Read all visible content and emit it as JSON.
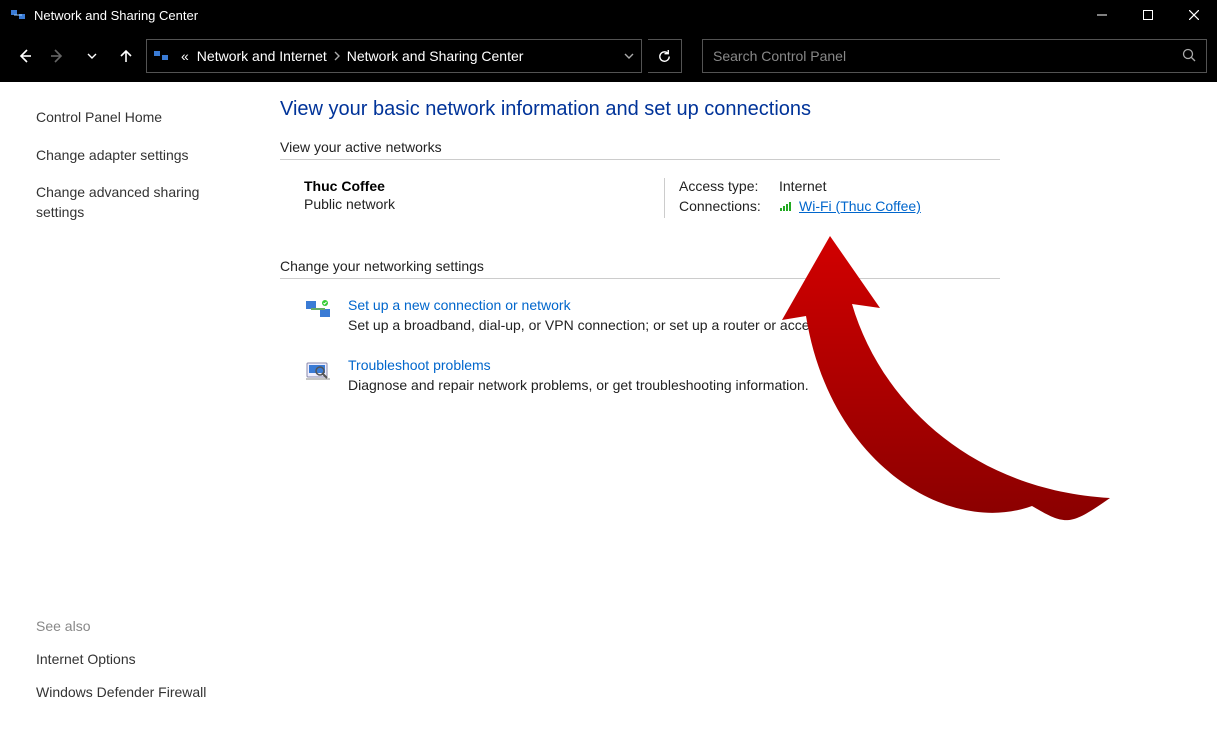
{
  "window": {
    "title": "Network and Sharing Center"
  },
  "breadcrumb": {
    "prefix": "«",
    "seg1": "Network and Internet",
    "seg2": "Network and Sharing Center"
  },
  "search": {
    "placeholder": "Search Control Panel"
  },
  "sidebar": {
    "home": "Control Panel Home",
    "adapter": "Change adapter settings",
    "advanced": "Change advanced sharing settings",
    "see_also": "See also",
    "internet_options": "Internet Options",
    "firewall": "Windows Defender Firewall"
  },
  "main": {
    "heading": "View your basic network information and set up connections",
    "active_header": "View your active networks",
    "network": {
      "name": "Thuc Coffee",
      "type": "Public network",
      "access_label": "Access type:",
      "access_value": "Internet",
      "connections_label": "Connections:",
      "connection_link": "Wi-Fi (Thuc Coffee)"
    },
    "change_header": "Change your networking settings",
    "setup": {
      "title": "Set up a new connection or network",
      "desc": "Set up a broadband, dial-up, or VPN connection; or set up a router or access point."
    },
    "troubleshoot": {
      "title": "Troubleshoot problems",
      "desc": "Diagnose and repair network problems, or get troubleshooting information."
    }
  }
}
